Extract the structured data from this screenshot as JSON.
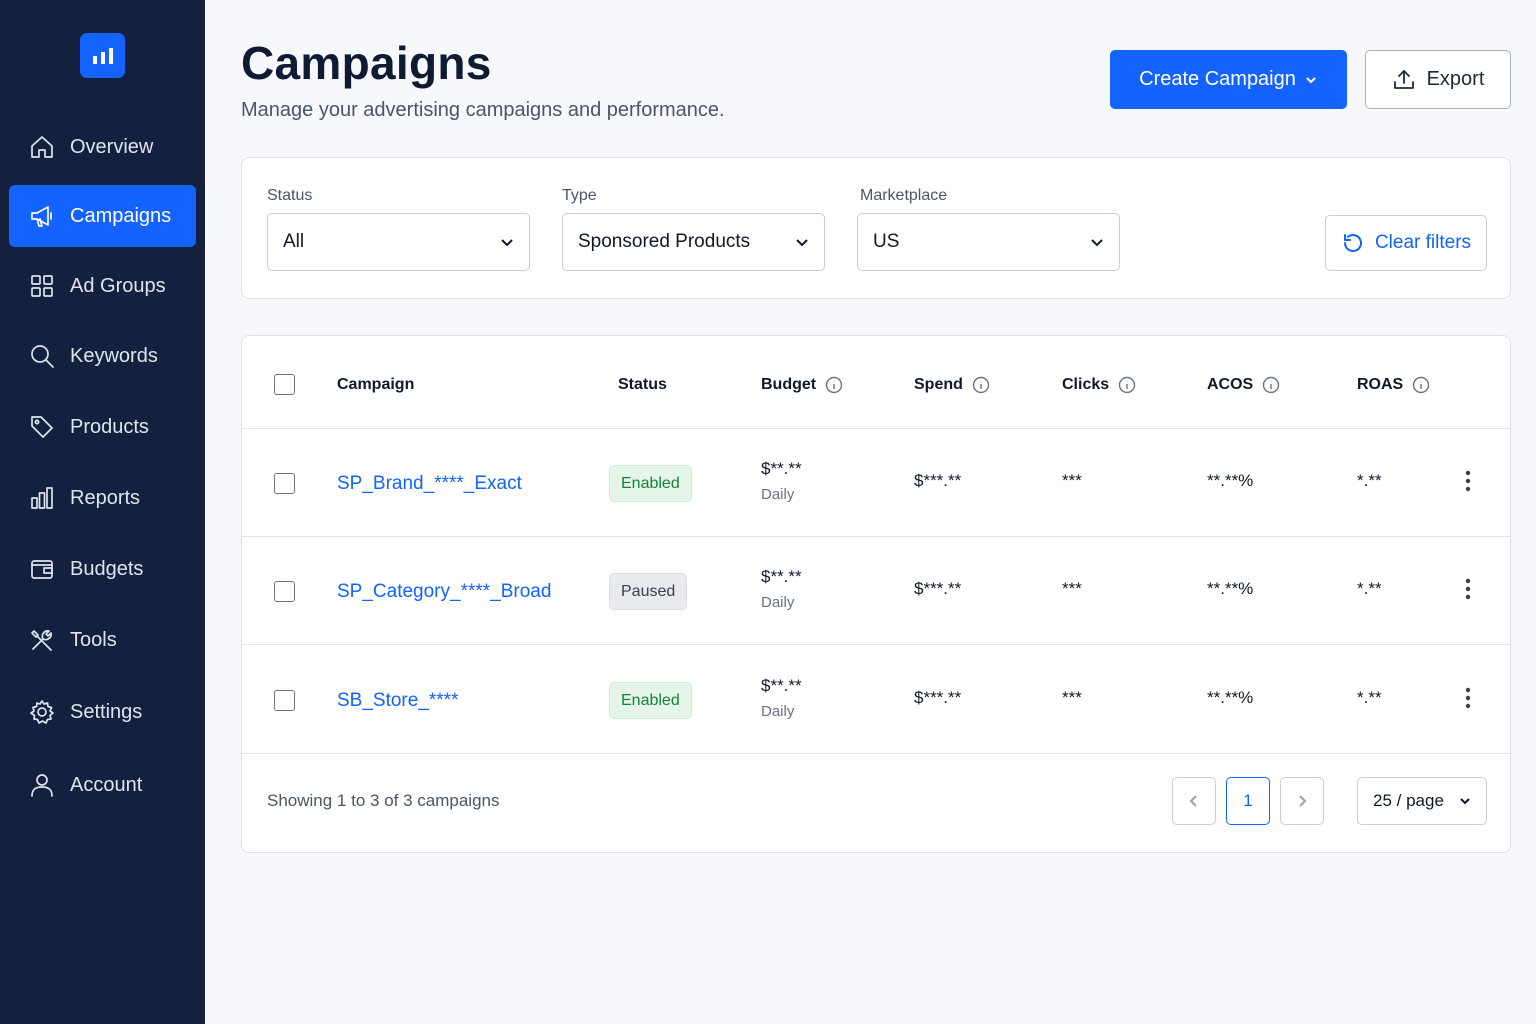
{
  "sidebar": {
    "items": [
      {
        "label": "Overview",
        "icon": "home-icon"
      },
      {
        "label": "Campaigns",
        "icon": "megaphone-icon",
        "active": true
      },
      {
        "label": "Ad Groups",
        "icon": "grid-icon"
      },
      {
        "label": "Keywords",
        "icon": "search-icon"
      },
      {
        "label": "Products",
        "icon": "tag-icon"
      },
      {
        "label": "Reports",
        "icon": "bar-chart-icon"
      },
      {
        "label": "Budgets",
        "icon": "wallet-icon"
      },
      {
        "label": "Tools",
        "icon": "tools-icon"
      },
      {
        "label": "Settings",
        "icon": "gear-icon"
      },
      {
        "label": "Account",
        "icon": "user-icon"
      }
    ]
  },
  "header": {
    "title": "Campaigns",
    "subtitle": "Manage your advertising campaigns and performance.",
    "create_label": "Create Campaign",
    "export_label": "Export"
  },
  "filters": {
    "status": {
      "label": "Status",
      "value": "All"
    },
    "type": {
      "label": "Type",
      "value": "Sponsored Products"
    },
    "marketplace": {
      "label": "Marketplace",
      "value": "US"
    },
    "clear_label": "Clear filters"
  },
  "table": {
    "columns": [
      "Campaign",
      "Status",
      "Budget",
      "Spend",
      "Clicks",
      "ACOS",
      "ROAS"
    ],
    "rows": [
      {
        "campaign": "SP_Brand_****_Exact",
        "status": "Enabled",
        "budget": "$**.**",
        "budget_period": "Daily",
        "spend": "$***.**",
        "clicks": "***",
        "acos": "**.**%",
        "roas": "*.**"
      },
      {
        "campaign": "SP_Category_****_Broad",
        "status": "Paused",
        "budget": "$**.**",
        "budget_period": "Daily",
        "spend": "$***.**",
        "clicks": "***",
        "acos": "**.**%",
        "roas": "*.**"
      },
      {
        "campaign": "SB_Store_****",
        "status": "Enabled",
        "budget": "$**.**",
        "budget_period": "Daily",
        "spend": "$***.**",
        "clicks": "***",
        "acos": "**.**%",
        "roas": "*.**"
      }
    ]
  },
  "footer": {
    "showing": "Showing 1 to 3 of 3 campaigns",
    "current_page": "1",
    "per_page": "25 / page"
  },
  "colors": {
    "sidebar_bg": "#13213f",
    "accent": "#1463ff",
    "enabled": "#15803d",
    "paused": "#374151"
  }
}
